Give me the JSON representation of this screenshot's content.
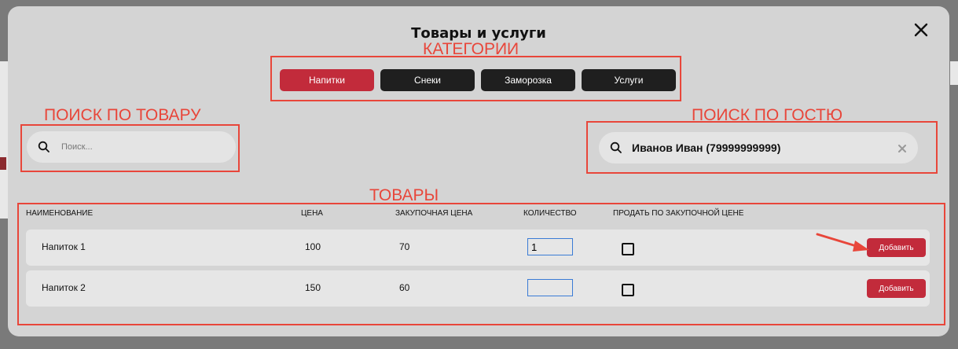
{
  "modal": {
    "title": "Товары и услуги",
    "close_icon": "close-icon"
  },
  "annotations": {
    "categories": "КАТЕГОРИИ",
    "product_search": "ПОИСК ПО ТОВАРУ",
    "guest_search": "ПОИСК ПО ГОСТЮ",
    "products": "ТОВАРЫ",
    "color": "#e8463a"
  },
  "categories": [
    {
      "label": "Напитки",
      "active": true
    },
    {
      "label": "Снеки",
      "active": false
    },
    {
      "label": "Заморозка",
      "active": false
    },
    {
      "label": "Услуги",
      "active": false
    }
  ],
  "product_search": {
    "placeholder": "Поиск...",
    "icon": "search-icon"
  },
  "guest_search": {
    "value": "Иванов Иван (79999999999)",
    "icon": "search-icon",
    "clear_icon": "close-icon"
  },
  "table": {
    "headers": {
      "name": "НАИМЕНОВАНИЕ",
      "price": "ЦЕНА",
      "purchase_price": "ЗАКУПОЧНАЯ ЦЕНА",
      "quantity": "КОЛИЧЕСТВО",
      "sell_at_purchase": "ПРОДАТЬ ПО ЗАКУПОЧНОЙ ЦЕНЕ"
    },
    "rows": [
      {
        "name": "Напиток 1",
        "price": "100",
        "purchase_price": "70",
        "quantity": "1",
        "sell_at_purchase": false,
        "action": "Добавить"
      },
      {
        "name": "Напиток 2",
        "price": "150",
        "purchase_price": "60",
        "quantity": "",
        "sell_at_purchase": false,
        "action": "Добавить"
      }
    ]
  },
  "colors": {
    "accent": "#c22b3b",
    "dark_button": "#1f1f1f",
    "modal_bg": "#d4d4d4"
  }
}
